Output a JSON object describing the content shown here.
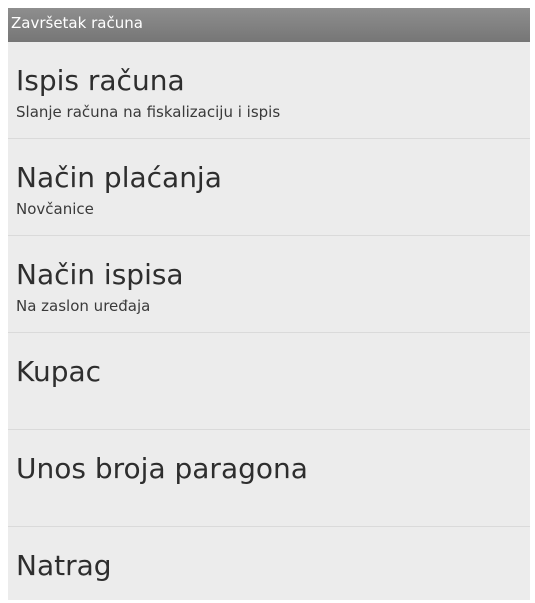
{
  "header": {
    "title": "Završetak računa"
  },
  "menu": {
    "items": [
      {
        "title": "Ispis računa",
        "subtitle": "Slanje računa na fiskalizaciju i ispis"
      },
      {
        "title": "Način plaćanja",
        "subtitle": "Novčanice"
      },
      {
        "title": "Način ispisa",
        "subtitle": "Na zaslon uređaja"
      },
      {
        "title": "Kupac",
        "subtitle": ""
      },
      {
        "title": "Unos broja paragona",
        "subtitle": ""
      },
      {
        "title": "Natrag",
        "subtitle": ""
      }
    ]
  }
}
